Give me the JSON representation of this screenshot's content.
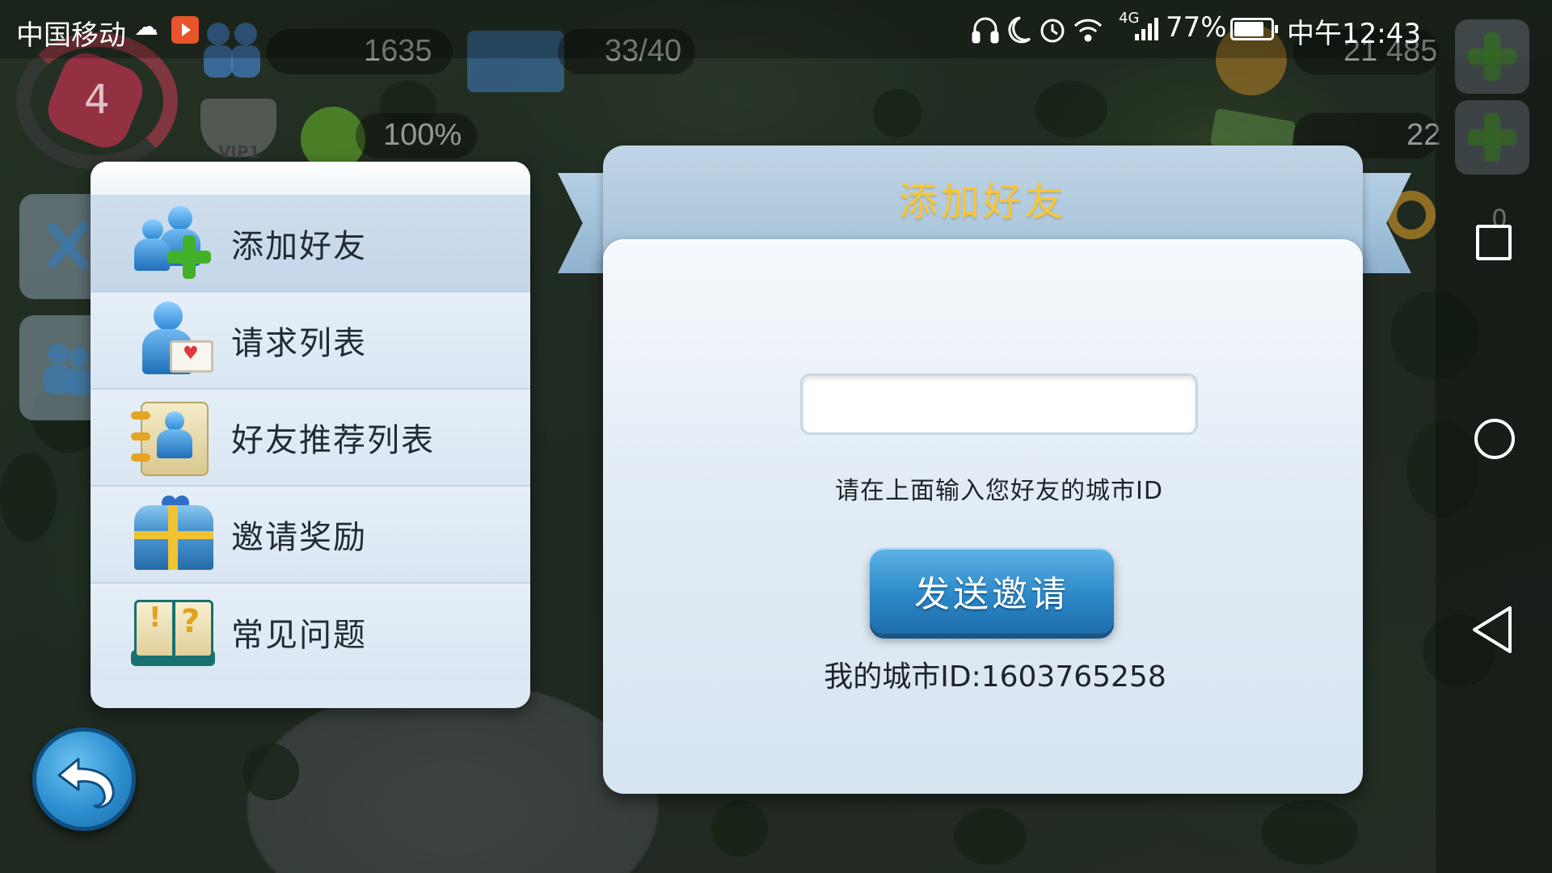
{
  "status_bar": {
    "carrier": "中国移动",
    "network": "4G",
    "battery": "77%",
    "time": "中午12:43",
    "icons": [
      "headphones-icon",
      "moon-icon",
      "alarm-icon",
      "wifi-icon",
      "signal-icon",
      "battery-icon"
    ]
  },
  "hud": {
    "level": "4",
    "population": "1635",
    "storage": "33/40",
    "happiness": "100%",
    "vip": "VIP1",
    "coins": "21 485",
    "cash": "22",
    "keys": "0"
  },
  "menu": {
    "items": [
      {
        "label": "添加好友",
        "icon": "add-friend-icon",
        "active": true
      },
      {
        "label": "请求列表",
        "icon": "request-list-icon",
        "active": false
      },
      {
        "label": "好友推荐列表",
        "icon": "friend-suggestions-icon",
        "active": false
      },
      {
        "label": "邀请奖励",
        "icon": "invite-reward-chest-icon",
        "active": false
      },
      {
        "label": "常见问题",
        "icon": "faq-book-icon",
        "active": false
      }
    ]
  },
  "dialog": {
    "title": "添加好友",
    "input_value": "",
    "input_placeholder": "",
    "hint": "请在上面输入您好友的城市ID",
    "send_button": "发送邀请",
    "my_city_id": "我的城市ID:1603765258"
  },
  "colors": {
    "title_gold": "#f8c635",
    "button_blue": "#2c88c8",
    "panel_light": "#dce8f3"
  }
}
